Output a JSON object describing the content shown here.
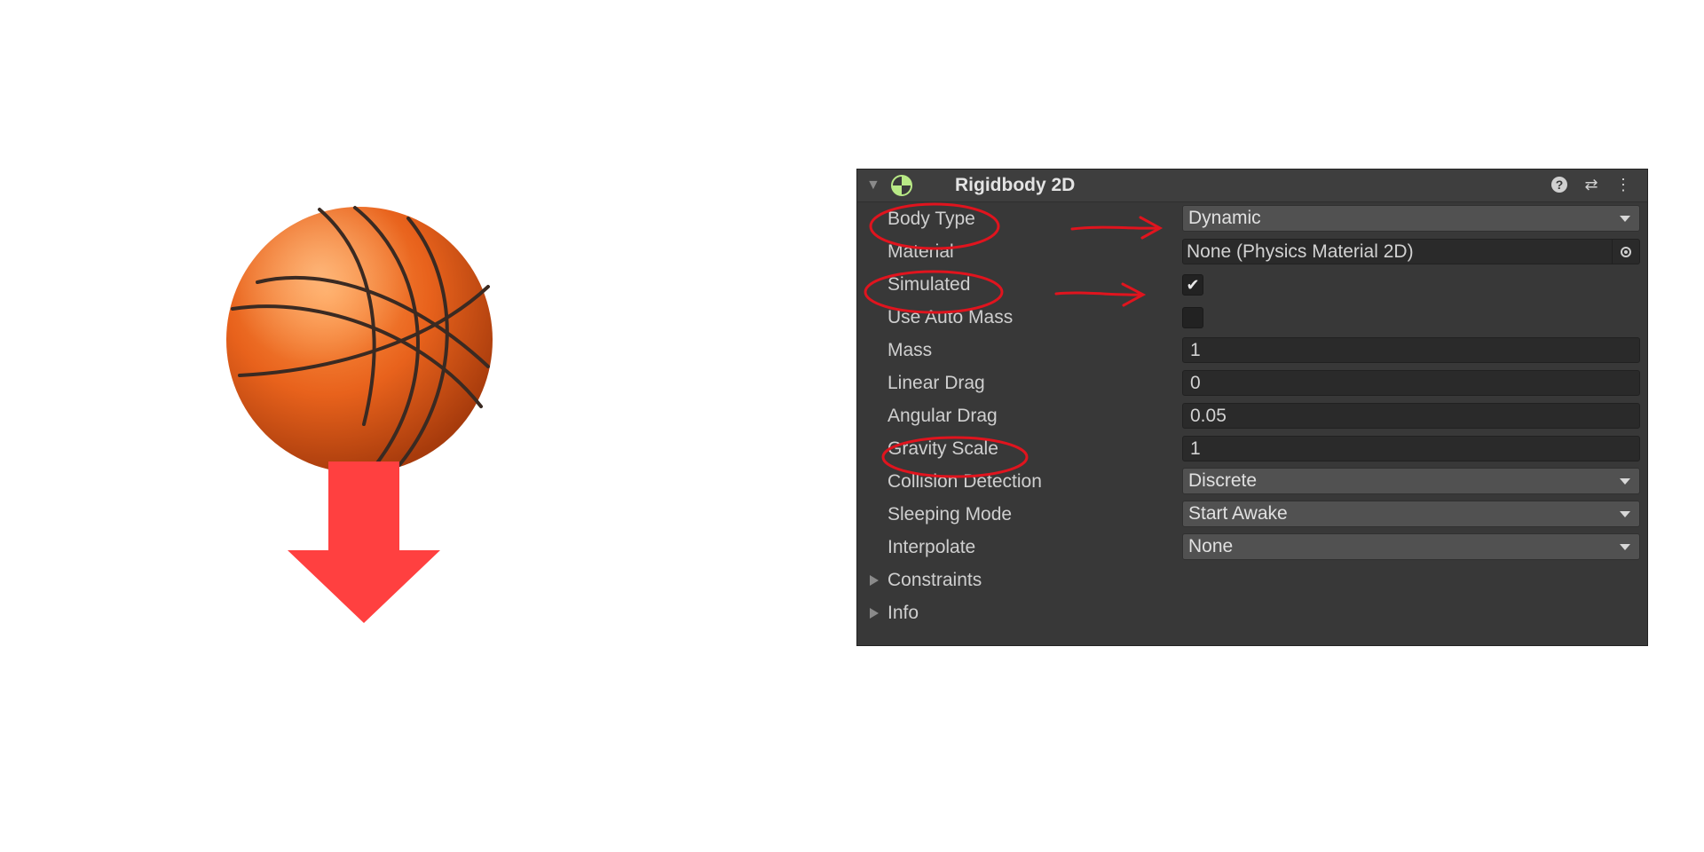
{
  "component": {
    "title": "Rigidbody 2D",
    "icon": "rigidbody2d-icon",
    "header_buttons": [
      "help-icon",
      "presets-icon",
      "more-options-icon"
    ]
  },
  "properties": {
    "body_type": {
      "label": "Body Type",
      "value": "Dynamic"
    },
    "material": {
      "label": "Material",
      "value": "None (Physics Material 2D)"
    },
    "simulated": {
      "label": "Simulated",
      "checked": true
    },
    "use_auto_mass": {
      "label": "Use Auto Mass",
      "checked": false
    },
    "mass": {
      "label": "Mass",
      "value": "1"
    },
    "linear_drag": {
      "label": "Linear Drag",
      "value": "0"
    },
    "angular_drag": {
      "label": "Angular Drag",
      "value": "0.05"
    },
    "gravity_scale": {
      "label": "Gravity Scale",
      "value": "1"
    },
    "collision_detection": {
      "label": "Collision Detection",
      "value": "Discrete"
    },
    "sleeping_mode": {
      "label": "Sleeping Mode",
      "value": "Start Awake"
    },
    "interpolate": {
      "label": "Interpolate",
      "value": "None"
    }
  },
  "foldouts": {
    "constraints": "Constraints",
    "info": "Info"
  },
  "glyphs": {
    "check": "✔",
    "fold_open": "▼",
    "presets": "⇄",
    "more": "⋮",
    "help": "?"
  },
  "colors": {
    "panel_bg": "#383838",
    "annotation_red": "#e0141e",
    "arrow_red": "#ff4040",
    "ball_orange": "#e8621c"
  },
  "illustration": {
    "ball": "basketball",
    "arrow": "down-arrow"
  }
}
